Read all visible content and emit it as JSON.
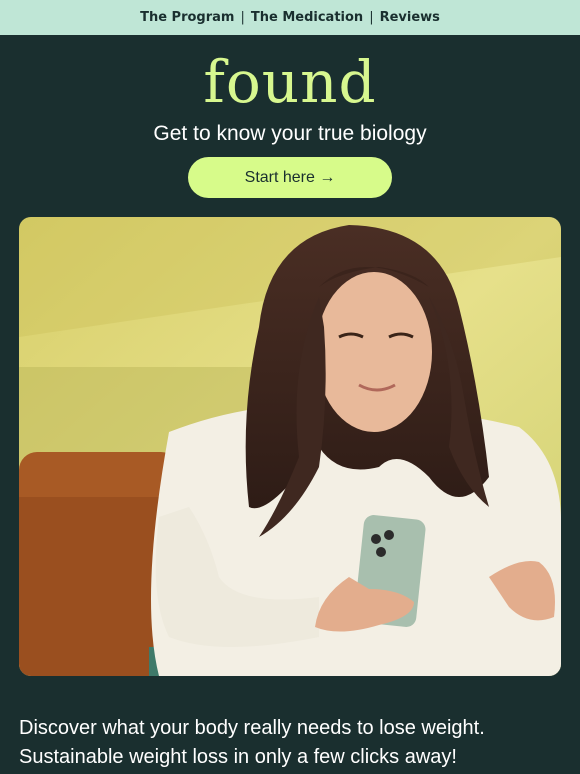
{
  "nav": {
    "items": [
      "The Program",
      "The Medication",
      "Reviews"
    ],
    "separator": "|"
  },
  "brand": {
    "logo_text": "found"
  },
  "hero": {
    "tagline": "Get to know your true biology",
    "cta_label": "Start here →"
  },
  "body": {
    "line1": "Discover what your body really needs to lose weight.",
    "line2": "Sustainable weight loss in only a few clicks away!"
  },
  "colors": {
    "background": "#1a2f2f",
    "nav_bg": "#bfe6d6",
    "accent": "#d7fb8a"
  }
}
